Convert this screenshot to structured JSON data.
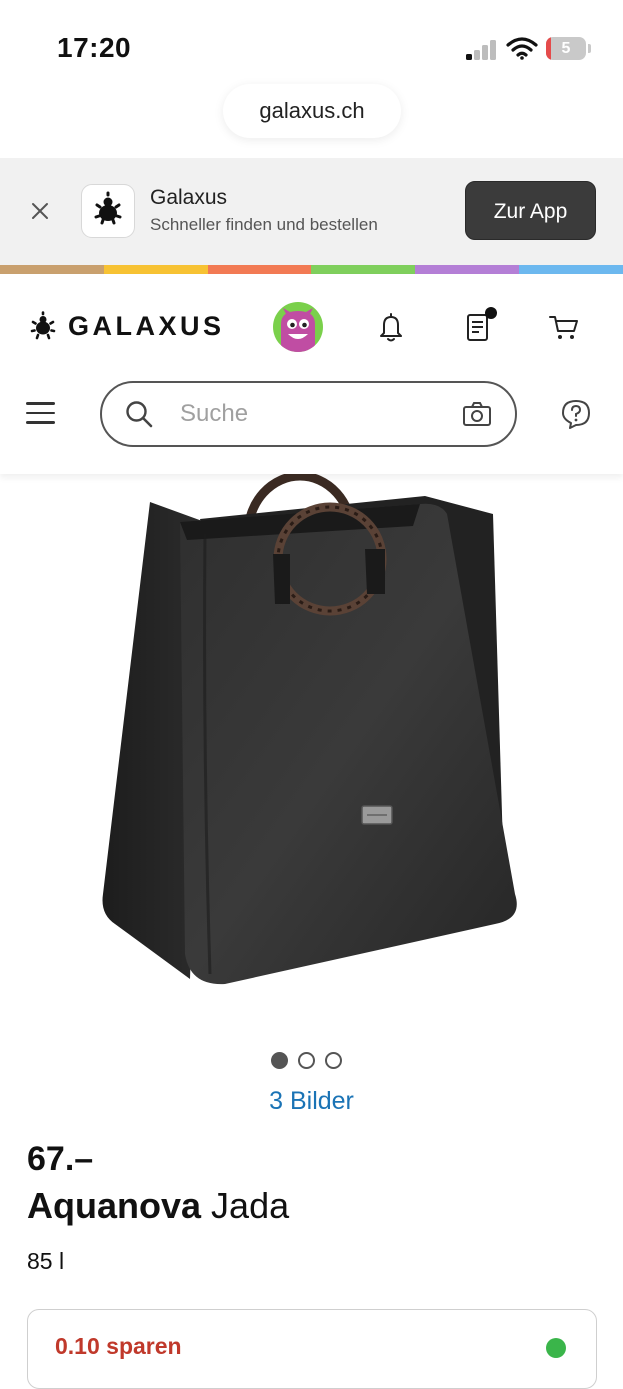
{
  "status_bar": {
    "time": "17:20",
    "battery_level": "5"
  },
  "browser": {
    "url": "galaxus.ch"
  },
  "app_banner": {
    "app_name": "Galaxus",
    "subtitle": "Schneller finden und bestellen",
    "open_button": "Zur App"
  },
  "stripe_colors": [
    "#c9a06e",
    "#f7c233",
    "#f27a54",
    "#7fcf5c",
    "#b47fd6",
    "#6cb8ef"
  ],
  "header": {
    "logo_text": "GALAXUS",
    "search_placeholder": "Suche"
  },
  "product": {
    "gallery": {
      "image_count_label": "3 Bilder",
      "total_images": 3,
      "active_index": 0
    },
    "price": "67.–",
    "brand": "Aquanova",
    "name": "Jada",
    "volume": "85 l",
    "savings_label": "0.10 sparen"
  },
  "colors": {
    "accent_link": "#1a73b5",
    "savings_red": "#c0392b",
    "stock_green": "#3ab54a",
    "button_dark": "#3b3b3b"
  }
}
